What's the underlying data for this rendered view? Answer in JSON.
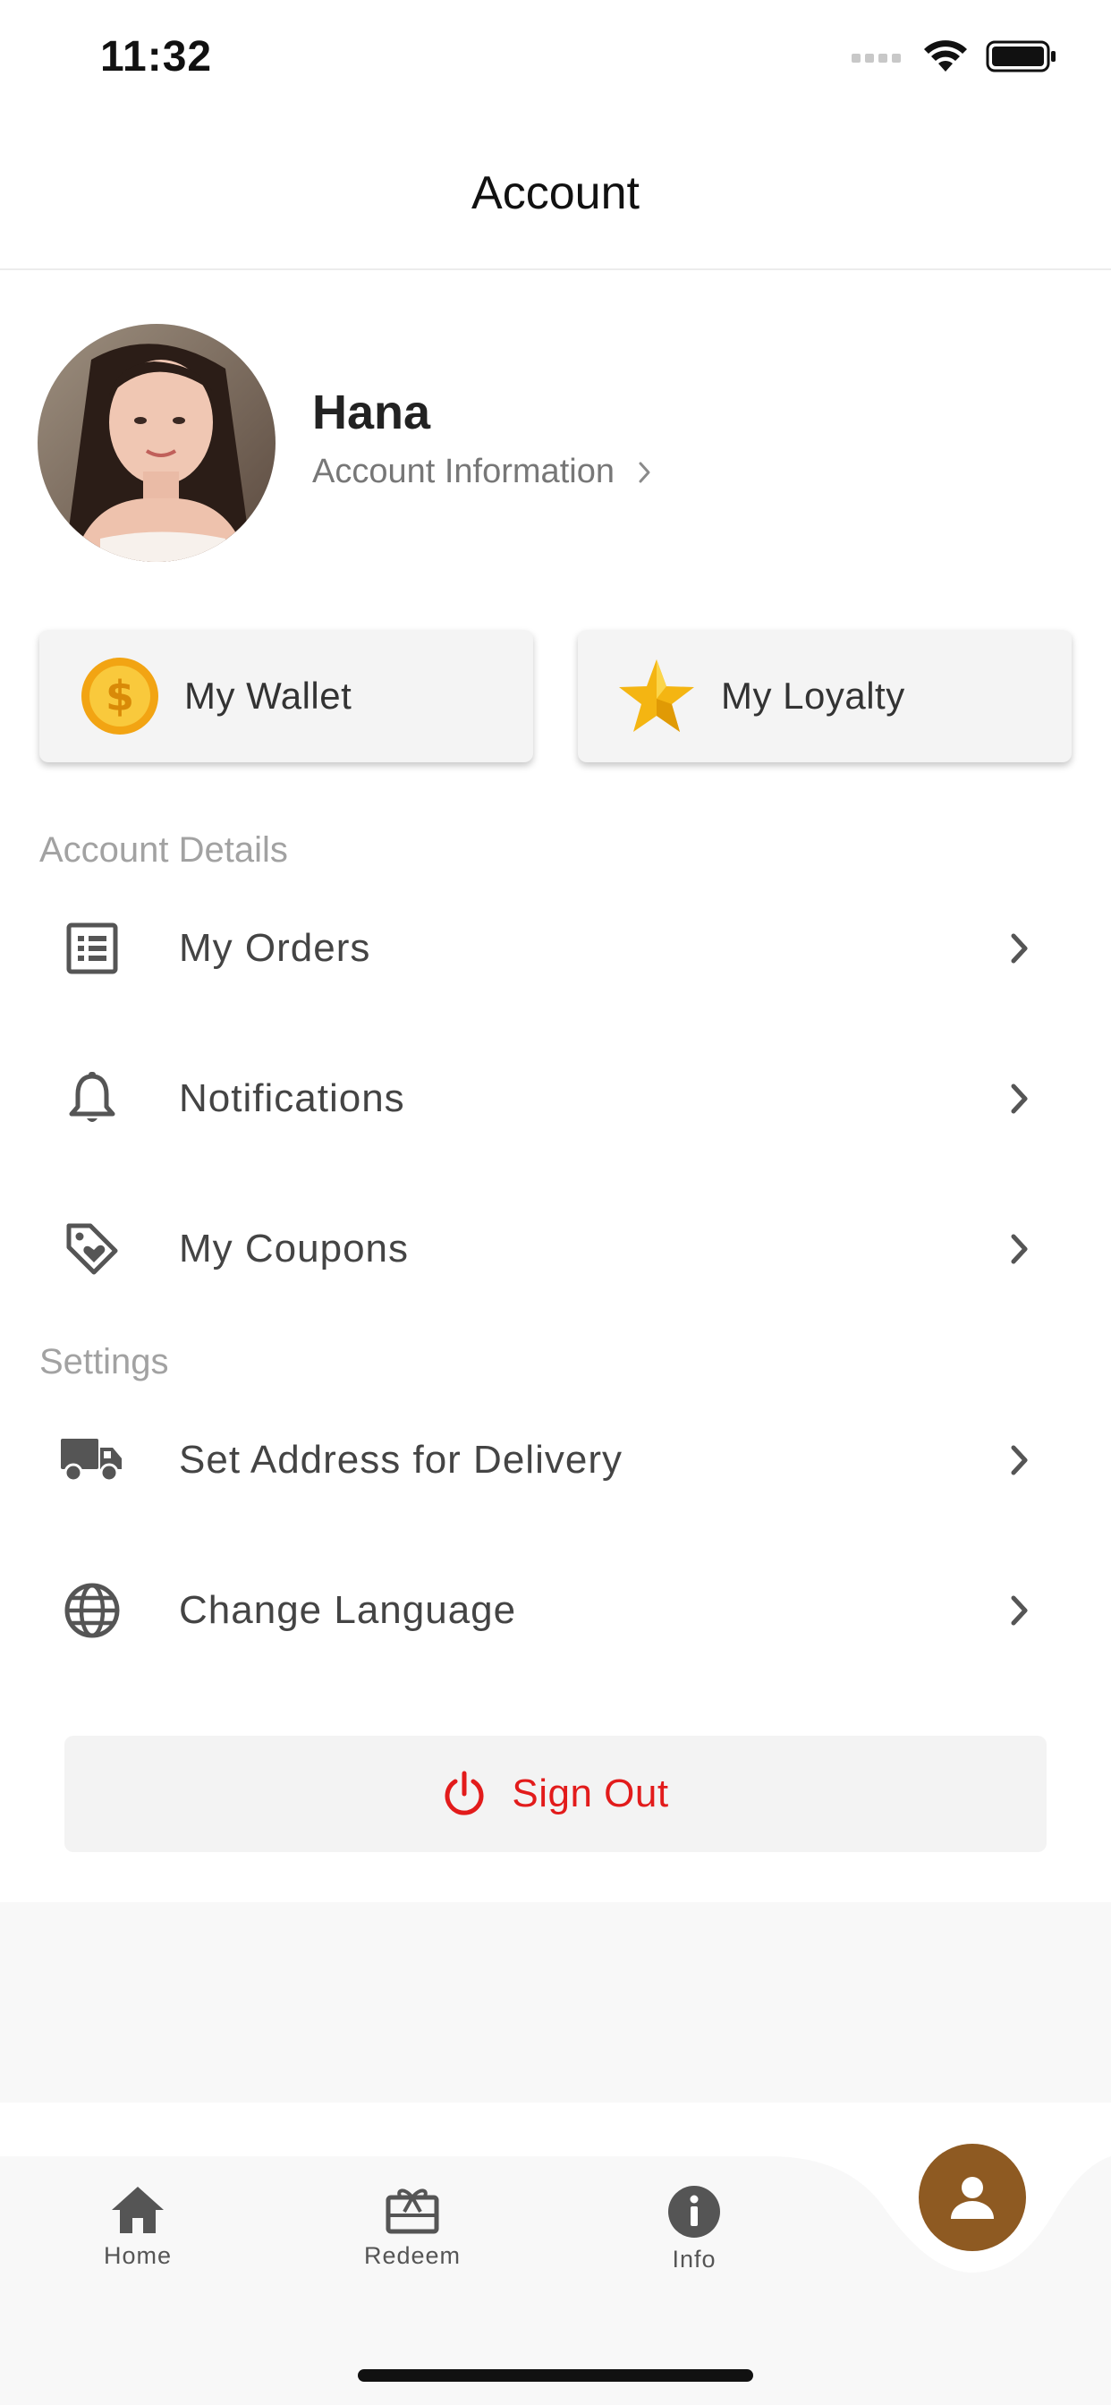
{
  "status_bar": {
    "time": "11:32"
  },
  "header": {
    "title": "Account"
  },
  "profile": {
    "name": "Hana",
    "link_label": "Account Information"
  },
  "quick_tiles": [
    {
      "label": "My Wallet",
      "icon": "coin-icon"
    },
    {
      "label": "My Loyalty",
      "icon": "star-icon"
    }
  ],
  "sections": {
    "account_details": {
      "title": "Account Details",
      "items": [
        {
          "label": "My Orders",
          "icon": "orders-list-icon"
        },
        {
          "label": "Notifications",
          "icon": "bell-icon"
        },
        {
          "label": "My Coupons",
          "icon": "coupon-tag-icon"
        }
      ]
    },
    "settings": {
      "title": "Settings",
      "items": [
        {
          "label": "Set Address for Delivery",
          "icon": "truck-icon"
        },
        {
          "label": "Change Language",
          "icon": "globe-icon"
        }
      ]
    }
  },
  "sign_out": {
    "label": "Sign Out",
    "icon": "power-icon",
    "color": "#e21b1b"
  },
  "tab_bar": {
    "tabs": [
      {
        "label": "Home",
        "icon": "home-icon"
      },
      {
        "label": "Redeem",
        "icon": "gift-card-icon"
      },
      {
        "label": "Info",
        "icon": "info-icon"
      }
    ],
    "active_tab_icon": "person-icon",
    "active_color": "#8e5a22"
  }
}
